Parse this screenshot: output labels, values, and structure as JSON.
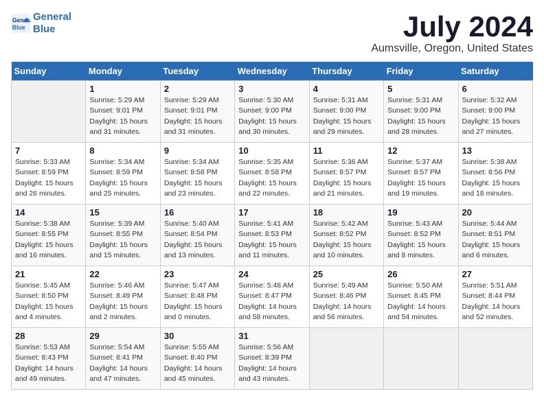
{
  "header": {
    "logo_line1": "General",
    "logo_line2": "Blue",
    "month": "July 2024",
    "location": "Aumsville, Oregon, United States"
  },
  "weekdays": [
    "Sunday",
    "Monday",
    "Tuesday",
    "Wednesday",
    "Thursday",
    "Friday",
    "Saturday"
  ],
  "weeks": [
    [
      {
        "day": "",
        "info": ""
      },
      {
        "day": "1",
        "info": "Sunrise: 5:29 AM\nSunset: 9:01 PM\nDaylight: 15 hours\nand 31 minutes."
      },
      {
        "day": "2",
        "info": "Sunrise: 5:29 AM\nSunset: 9:01 PM\nDaylight: 15 hours\nand 31 minutes."
      },
      {
        "day": "3",
        "info": "Sunrise: 5:30 AM\nSunset: 9:00 PM\nDaylight: 15 hours\nand 30 minutes."
      },
      {
        "day": "4",
        "info": "Sunrise: 5:31 AM\nSunset: 9:00 PM\nDaylight: 15 hours\nand 29 minutes."
      },
      {
        "day": "5",
        "info": "Sunrise: 5:31 AM\nSunset: 9:00 PM\nDaylight: 15 hours\nand 28 minutes."
      },
      {
        "day": "6",
        "info": "Sunrise: 5:32 AM\nSunset: 9:00 PM\nDaylight: 15 hours\nand 27 minutes."
      }
    ],
    [
      {
        "day": "7",
        "info": "Sunrise: 5:33 AM\nSunset: 8:59 PM\nDaylight: 15 hours\nand 26 minutes."
      },
      {
        "day": "8",
        "info": "Sunrise: 5:34 AM\nSunset: 8:59 PM\nDaylight: 15 hours\nand 25 minutes."
      },
      {
        "day": "9",
        "info": "Sunrise: 5:34 AM\nSunset: 8:58 PM\nDaylight: 15 hours\nand 23 minutes."
      },
      {
        "day": "10",
        "info": "Sunrise: 5:35 AM\nSunset: 8:58 PM\nDaylight: 15 hours\nand 22 minutes."
      },
      {
        "day": "11",
        "info": "Sunrise: 5:36 AM\nSunset: 8:57 PM\nDaylight: 15 hours\nand 21 minutes."
      },
      {
        "day": "12",
        "info": "Sunrise: 5:37 AM\nSunset: 8:57 PM\nDaylight: 15 hours\nand 19 minutes."
      },
      {
        "day": "13",
        "info": "Sunrise: 5:38 AM\nSunset: 8:56 PM\nDaylight: 15 hours\nand 18 minutes."
      }
    ],
    [
      {
        "day": "14",
        "info": "Sunrise: 5:38 AM\nSunset: 8:55 PM\nDaylight: 15 hours\nand 16 minutes."
      },
      {
        "day": "15",
        "info": "Sunrise: 5:39 AM\nSunset: 8:55 PM\nDaylight: 15 hours\nand 15 minutes."
      },
      {
        "day": "16",
        "info": "Sunrise: 5:40 AM\nSunset: 8:54 PM\nDaylight: 15 hours\nand 13 minutes."
      },
      {
        "day": "17",
        "info": "Sunrise: 5:41 AM\nSunset: 8:53 PM\nDaylight: 15 hours\nand 11 minutes."
      },
      {
        "day": "18",
        "info": "Sunrise: 5:42 AM\nSunset: 8:52 PM\nDaylight: 15 hours\nand 10 minutes."
      },
      {
        "day": "19",
        "info": "Sunrise: 5:43 AM\nSunset: 8:52 PM\nDaylight: 15 hours\nand 8 minutes."
      },
      {
        "day": "20",
        "info": "Sunrise: 5:44 AM\nSunset: 8:51 PM\nDaylight: 15 hours\nand 6 minutes."
      }
    ],
    [
      {
        "day": "21",
        "info": "Sunrise: 5:45 AM\nSunset: 8:50 PM\nDaylight: 15 hours\nand 4 minutes."
      },
      {
        "day": "22",
        "info": "Sunrise: 5:46 AM\nSunset: 8:49 PM\nDaylight: 15 hours\nand 2 minutes."
      },
      {
        "day": "23",
        "info": "Sunrise: 5:47 AM\nSunset: 8:48 PM\nDaylight: 15 hours\nand 0 minutes."
      },
      {
        "day": "24",
        "info": "Sunrise: 5:48 AM\nSunset: 8:47 PM\nDaylight: 14 hours\nand 58 minutes."
      },
      {
        "day": "25",
        "info": "Sunrise: 5:49 AM\nSunset: 8:46 PM\nDaylight: 14 hours\nand 56 minutes."
      },
      {
        "day": "26",
        "info": "Sunrise: 5:50 AM\nSunset: 8:45 PM\nDaylight: 14 hours\nand 54 minutes."
      },
      {
        "day": "27",
        "info": "Sunrise: 5:51 AM\nSunset: 8:44 PM\nDaylight: 14 hours\nand 52 minutes."
      }
    ],
    [
      {
        "day": "28",
        "info": "Sunrise: 5:53 AM\nSunset: 8:43 PM\nDaylight: 14 hours\nand 49 minutes."
      },
      {
        "day": "29",
        "info": "Sunrise: 5:54 AM\nSunset: 8:41 PM\nDaylight: 14 hours\nand 47 minutes."
      },
      {
        "day": "30",
        "info": "Sunrise: 5:55 AM\nSunset: 8:40 PM\nDaylight: 14 hours\nand 45 minutes."
      },
      {
        "day": "31",
        "info": "Sunrise: 5:56 AM\nSunset: 8:39 PM\nDaylight: 14 hours\nand 43 minutes."
      },
      {
        "day": "",
        "info": ""
      },
      {
        "day": "",
        "info": ""
      },
      {
        "day": "",
        "info": ""
      }
    ]
  ]
}
